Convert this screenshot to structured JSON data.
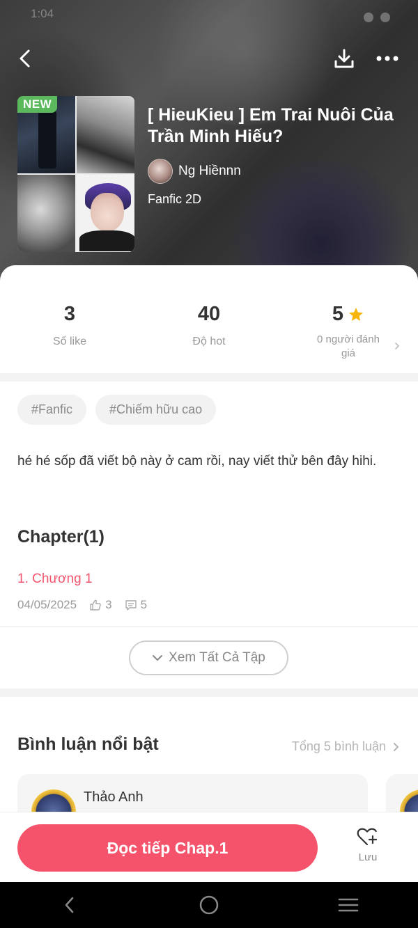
{
  "story": {
    "badge": "NEW",
    "title": "[ HieuKieu ] Em Trai Nuôi Của Trần Minh Hiếu?",
    "author": "Ng Hiềnnn",
    "genre": "Fanfic 2D"
  },
  "stats": {
    "likes_value": "3",
    "likes_label": "Số like",
    "hot_value": "40",
    "hot_label": "Độ hot",
    "rating_value": "5",
    "rating_label": "0 người đánh giá"
  },
  "tags": [
    "#Fanfic",
    "#Chiếm hữu cao"
  ],
  "description": "hé hé sốp đã viết bộ này ở cam rồi, nay viết thử bên đây hihi.",
  "chapters": {
    "heading": "Chapter(1)",
    "items": [
      {
        "title": "1. Chương 1",
        "date": "04/05/2025",
        "likes": "3",
        "comments": "5"
      }
    ],
    "view_all_label": "Xem Tất Cả Tập"
  },
  "comments": {
    "heading": "Bình luận nổi bật",
    "total_label": "Tổng 5 bình luận",
    "items": [
      {
        "name": "Thảo Anh"
      }
    ]
  },
  "bottom": {
    "read_label": "Đọc tiếp Chap.1",
    "save_label": "Lưu"
  },
  "status_bar": {
    "time": "1:04"
  },
  "colors": {
    "accent": "#f5536c",
    "link": "#f2566e",
    "badge": "#5cb85c",
    "star": "#f5b50a"
  }
}
